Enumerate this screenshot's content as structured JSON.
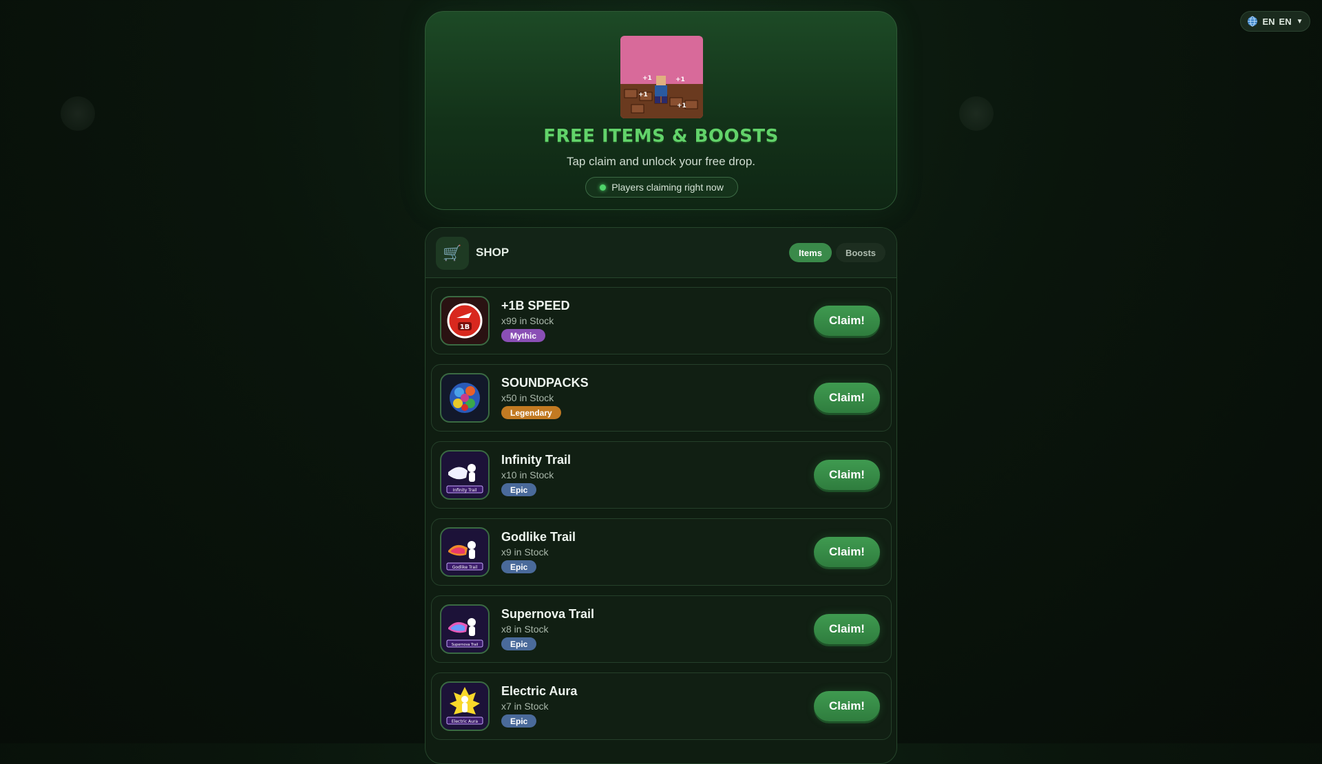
{
  "lang": {
    "current": "EN",
    "selected": "EN"
  },
  "hero": {
    "image_alt_text": "+1 SPEED KEYBOARD ESCAPE",
    "title": "FREE ITEMS & BOOSTS",
    "subtitle": "Tap claim and unlock your free drop.",
    "live_text": "Players claiming right now"
  },
  "shop": {
    "title": "SHOP",
    "tabs": [
      {
        "label": "Items",
        "active": true
      },
      {
        "label": "Boosts",
        "active": false
      }
    ],
    "claim_label": "Claim!",
    "items": [
      {
        "name": "+1B SPEED",
        "stock": "x99 in Stock",
        "rarity": "Mythic",
        "rarity_color": "#8a4fb5",
        "icon": "speed-1b-icon"
      },
      {
        "name": "SOUNDPACKS",
        "stock": "x50 in Stock",
        "rarity": "Legendary",
        "rarity_color": "#c27a22",
        "icon": "soundpacks-icon"
      },
      {
        "name": "Infinity Trail",
        "stock": "x10 in Stock",
        "rarity": "Epic",
        "rarity_color": "#4a6a9a",
        "icon": "infinity-trail-icon",
        "icon_caption": "Infinity Trail"
      },
      {
        "name": "Godlike Trail",
        "stock": "x9 in Stock",
        "rarity": "Epic",
        "rarity_color": "#4a6a9a",
        "icon": "godlike-trail-icon",
        "icon_caption": "Godlike Trail"
      },
      {
        "name": "Supernova Trail",
        "stock": "x8 in Stock",
        "rarity": "Epic",
        "rarity_color": "#4a6a9a",
        "icon": "supernova-trail-icon",
        "icon_caption": "Supernova Trail"
      },
      {
        "name": "Electric Aura",
        "stock": "x7 in Stock",
        "rarity": "Epic",
        "rarity_color": "#4a6a9a",
        "icon": "electric-aura-icon",
        "icon_caption": "Electric Aura"
      }
    ]
  }
}
